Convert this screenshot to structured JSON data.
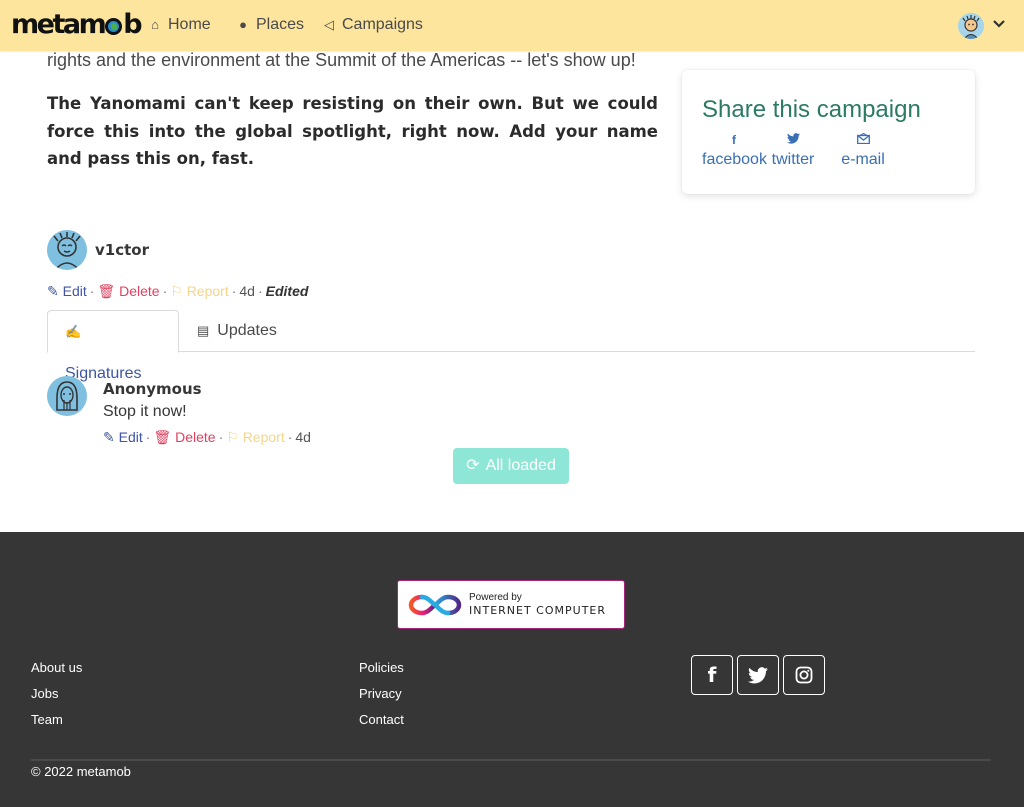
{
  "navbar": {
    "logo": "metamob",
    "home": "Home",
    "places": "Places",
    "campaigns": "Campaigns",
    "icons": {
      "home": "home-icon",
      "places": "globe-icon",
      "campaigns": "megaphone-icon",
      "user": "user-avatar",
      "menu": "chevron-down-icon"
    }
  },
  "campaign": {
    "intro_line": "rights and the environment at the Summit of the Americas -- let's show up!",
    "bold_paragraph": "The Yanomami can't keep resisting on their own. But we could force this into the global spotlight, right now. Add your name and pass this on, fast.",
    "author": "v1ctor",
    "actions": {
      "edit": "Edit",
      "delete": "Delete",
      "report": "Report",
      "age": "4d",
      "edited": "Edited"
    }
  },
  "share": {
    "title": "Share this campaign",
    "facebook": "facebook",
    "twitter": "twitter",
    "email": "e-mail"
  },
  "tabs": {
    "signatures": "Signatures",
    "updates": "Updates"
  },
  "signatures": [
    {
      "name": "Anonymous",
      "message": "Stop it now!",
      "edit": "Edit",
      "delete": "Delete",
      "report": "Report",
      "age": "4d"
    }
  ],
  "load_button": "All loaded",
  "footer": {
    "badge_top": "Powered by",
    "badge_bottom": "INTERNET COMPUTER",
    "col1": [
      "About us",
      "Jobs",
      "Team"
    ],
    "col2": [
      "Policies",
      "Privacy",
      "Contact"
    ],
    "social": {
      "facebook": "f",
      "twitter": "twitter-icon",
      "instagram": "instagram-icon"
    },
    "copyright": "© 2022 metamob"
  },
  "colors": {
    "navbar": "#fde59d",
    "footer": "#363636",
    "accent": "#3e56a3",
    "share_title": "#2b7a64",
    "danger": "#e0405e",
    "button": "#8ee6d6"
  }
}
